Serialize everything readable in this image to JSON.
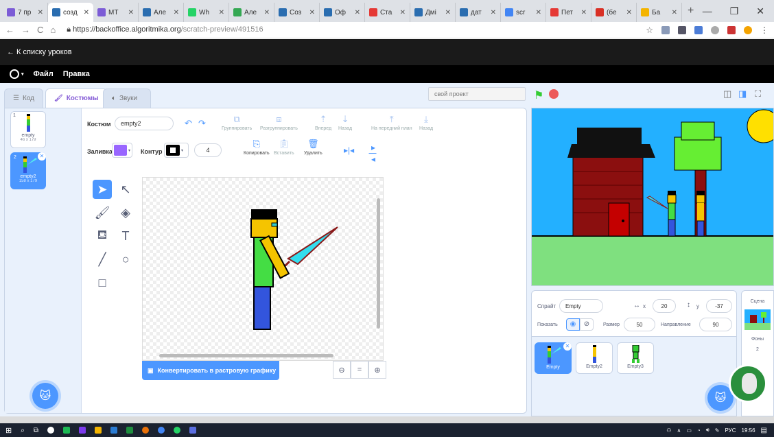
{
  "browser": {
    "tabs": [
      {
        "label": "7 пр",
        "color": "#7c5cd6"
      },
      {
        "label": "созд",
        "color": "#2a6db0",
        "active": true
      },
      {
        "label": "МТ",
        "color": "#7c5cd6"
      },
      {
        "label": "Але",
        "color": "#2a6db0"
      },
      {
        "label": "Wh",
        "color": "#25d366"
      },
      {
        "label": "Але",
        "color": "#34a853"
      },
      {
        "label": "Соз",
        "color": "#2a6db0"
      },
      {
        "label": "Оф",
        "color": "#2a6db0"
      },
      {
        "label": "Ста",
        "color": "#e53935"
      },
      {
        "label": "Дмі",
        "color": "#2a6db0"
      },
      {
        "label": "дат",
        "color": "#2a6db0"
      },
      {
        "label": "scr",
        "color": "#4285f4"
      },
      {
        "label": "Пет",
        "color": "#e53935"
      },
      {
        "label": "(бе",
        "color": "#d93025"
      },
      {
        "label": "Ба",
        "color": "#f4b400"
      }
    ],
    "new_tab": "+",
    "url_host": "https://backoffice.algoritmika.org",
    "url_path": "/scratch-preview/491516"
  },
  "app": {
    "back_link": "← К списку уроков",
    "menu_file": "Файл",
    "menu_edit": "Правка"
  },
  "editor": {
    "tab_code": "Код",
    "tab_costumes": "Костюмы",
    "tab_sounds": "Звуки",
    "costumes": [
      {
        "num": "1",
        "name": "empty",
        "size": "46 x 179"
      },
      {
        "num": "2",
        "name": "empty2",
        "size": "158 x 179"
      }
    ],
    "costume_label": "Костюм",
    "costume_name": "empty2",
    "fill_label": "Заливка",
    "outline_label": "Контур",
    "outline_width": "4",
    "fill_color": "#9966ff",
    "outline_color": "#000000",
    "group": "Группировать",
    "ungroup": "Разгруппировать",
    "forward": "Вперед",
    "backward": "Назад",
    "front": "На передний план",
    "back": "Назад",
    "copy": "Копировать",
    "paste": "Вставить",
    "delete": "Удалить",
    "convert": "Конвертировать в растровую графику",
    "zoom_reset": "="
  },
  "stage": {
    "project_name": "свой проект"
  },
  "sprite": {
    "sprite_label": "Спрайт",
    "sprite_name": "Empty",
    "x_label": "x",
    "x": "20",
    "y_label": "y",
    "y": "-37",
    "show_label": "Показать",
    "size_label": "Размер",
    "size": "50",
    "direction_label": "Направление",
    "direction": "90",
    "sprites": [
      "Empty",
      "Empty2",
      "Empty3"
    ]
  },
  "scene": {
    "label": "Сцена",
    "backdrops_label": "Фоны",
    "backdrops_count": "2"
  },
  "taskbar": {
    "lang": "РУС",
    "time": "19:56"
  }
}
